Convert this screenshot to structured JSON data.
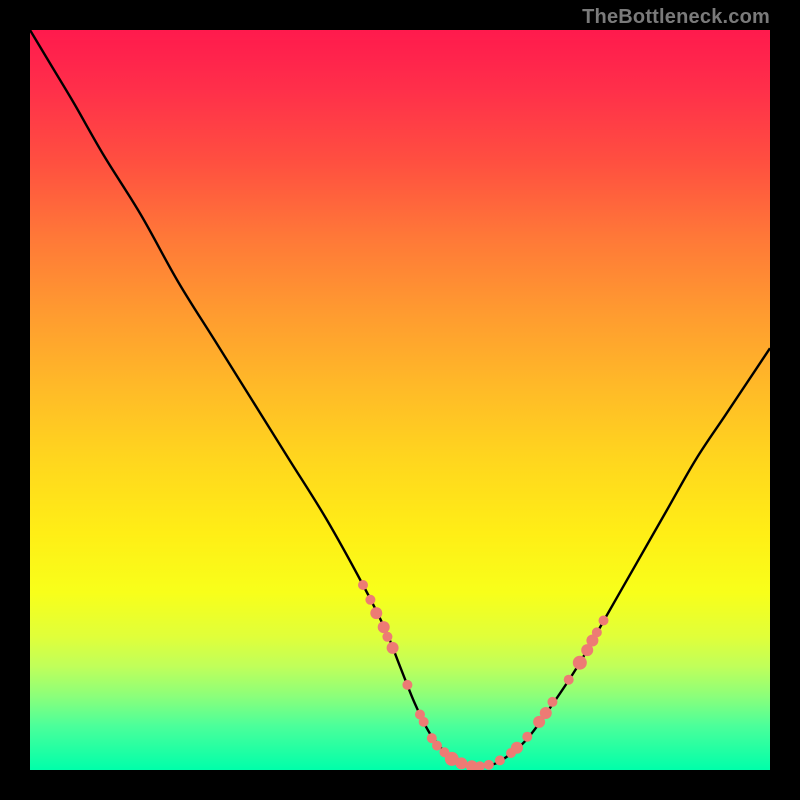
{
  "attribution": "TheBottleneck.com",
  "colors": {
    "background": "#000000",
    "gradient_top": "#ff1a4d",
    "gradient_bottom": "#00ffaa",
    "curve": "#000000",
    "markers": "#ed7b74"
  },
  "chart_data": {
    "type": "line",
    "title": "",
    "xlabel": "",
    "ylabel": "",
    "xlim": [
      0,
      100
    ],
    "ylim": [
      0,
      100
    ],
    "series": [
      {
        "name": "bottleneck-curve",
        "x": [
          0,
          3,
          6,
          10,
          15,
          20,
          25,
          30,
          35,
          40,
          45,
          48,
          50,
          52,
          54,
          56,
          58,
          60,
          62,
          64,
          67,
          70,
          74,
          78,
          82,
          86,
          90,
          94,
          98,
          100
        ],
        "values": [
          100,
          95,
          90,
          83,
          75,
          66,
          58,
          50,
          42,
          34,
          25,
          19,
          14,
          9,
          5,
          2.5,
          1,
          0.5,
          0.6,
          1.5,
          4,
          8,
          14,
          21,
          28,
          35,
          42,
          48,
          54,
          57
        ]
      }
    ],
    "markers": [
      {
        "x": 45.0,
        "y": 25.0,
        "r": 5
      },
      {
        "x": 46.0,
        "y": 23.0,
        "r": 5
      },
      {
        "x": 46.8,
        "y": 21.2,
        "r": 6
      },
      {
        "x": 47.8,
        "y": 19.3,
        "r": 6
      },
      {
        "x": 48.3,
        "y": 18.0,
        "r": 5
      },
      {
        "x": 49.0,
        "y": 16.5,
        "r": 6
      },
      {
        "x": 51.0,
        "y": 11.5,
        "r": 5
      },
      {
        "x": 52.7,
        "y": 7.5,
        "r": 5
      },
      {
        "x": 53.2,
        "y": 6.5,
        "r": 5
      },
      {
        "x": 54.3,
        "y": 4.3,
        "r": 5
      },
      {
        "x": 55.0,
        "y": 3.3,
        "r": 5
      },
      {
        "x": 56.0,
        "y": 2.4,
        "r": 5
      },
      {
        "x": 57.0,
        "y": 1.5,
        "r": 7
      },
      {
        "x": 58.3,
        "y": 0.9,
        "r": 6
      },
      {
        "x": 59.7,
        "y": 0.5,
        "r": 6
      },
      {
        "x": 60.8,
        "y": 0.5,
        "r": 5
      },
      {
        "x": 62.0,
        "y": 0.7,
        "r": 5
      },
      {
        "x": 63.5,
        "y": 1.3,
        "r": 5
      },
      {
        "x": 65.0,
        "y": 2.3,
        "r": 5
      },
      {
        "x": 65.8,
        "y": 3.0,
        "r": 6
      },
      {
        "x": 67.2,
        "y": 4.5,
        "r": 5
      },
      {
        "x": 68.8,
        "y": 6.5,
        "r": 6
      },
      {
        "x": 69.7,
        "y": 7.7,
        "r": 6
      },
      {
        "x": 70.6,
        "y": 9.2,
        "r": 5
      },
      {
        "x": 72.8,
        "y": 12.2,
        "r": 5
      },
      {
        "x": 74.3,
        "y": 14.5,
        "r": 7
      },
      {
        "x": 75.3,
        "y": 16.2,
        "r": 6
      },
      {
        "x": 76.0,
        "y": 17.5,
        "r": 6
      },
      {
        "x": 76.6,
        "y": 18.6,
        "r": 5
      },
      {
        "x": 77.5,
        "y": 20.2,
        "r": 5
      }
    ]
  }
}
